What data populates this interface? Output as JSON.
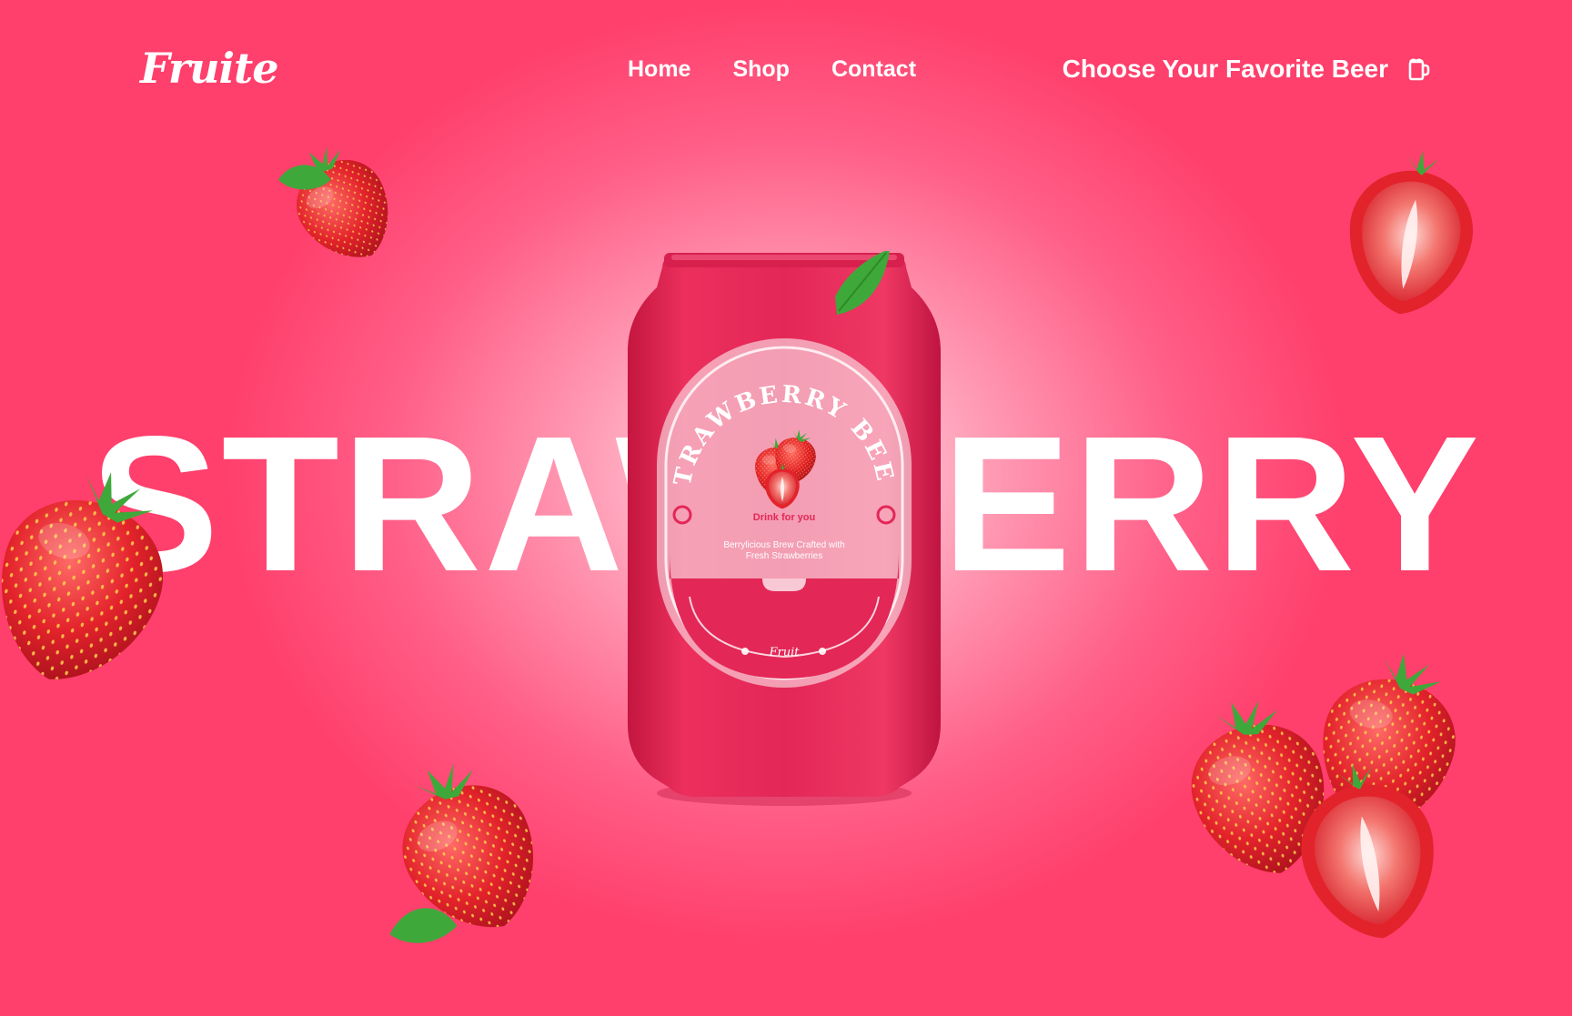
{
  "brand": {
    "logo": "Fruite"
  },
  "nav": {
    "items": [
      {
        "label": "Home"
      },
      {
        "label": "Shop"
      },
      {
        "label": "Contact"
      }
    ]
  },
  "cta": {
    "label": "Choose Your Favorite Beer",
    "icon": "beer-mug-icon"
  },
  "hero": {
    "headline": "STRAWBERRY"
  },
  "can": {
    "arc_title": "STRAWBERRY BEER",
    "tagline": "Drink for you",
    "description_line1": "Berrylicious Brew Crafted with",
    "description_line2": "Fresh Strawberries",
    "signature": "Fruit"
  },
  "colors": {
    "background": "#ff4571",
    "can": "#e42656",
    "text": "#ffffff",
    "berry": "#e52630",
    "leaf": "#3fa83a"
  }
}
